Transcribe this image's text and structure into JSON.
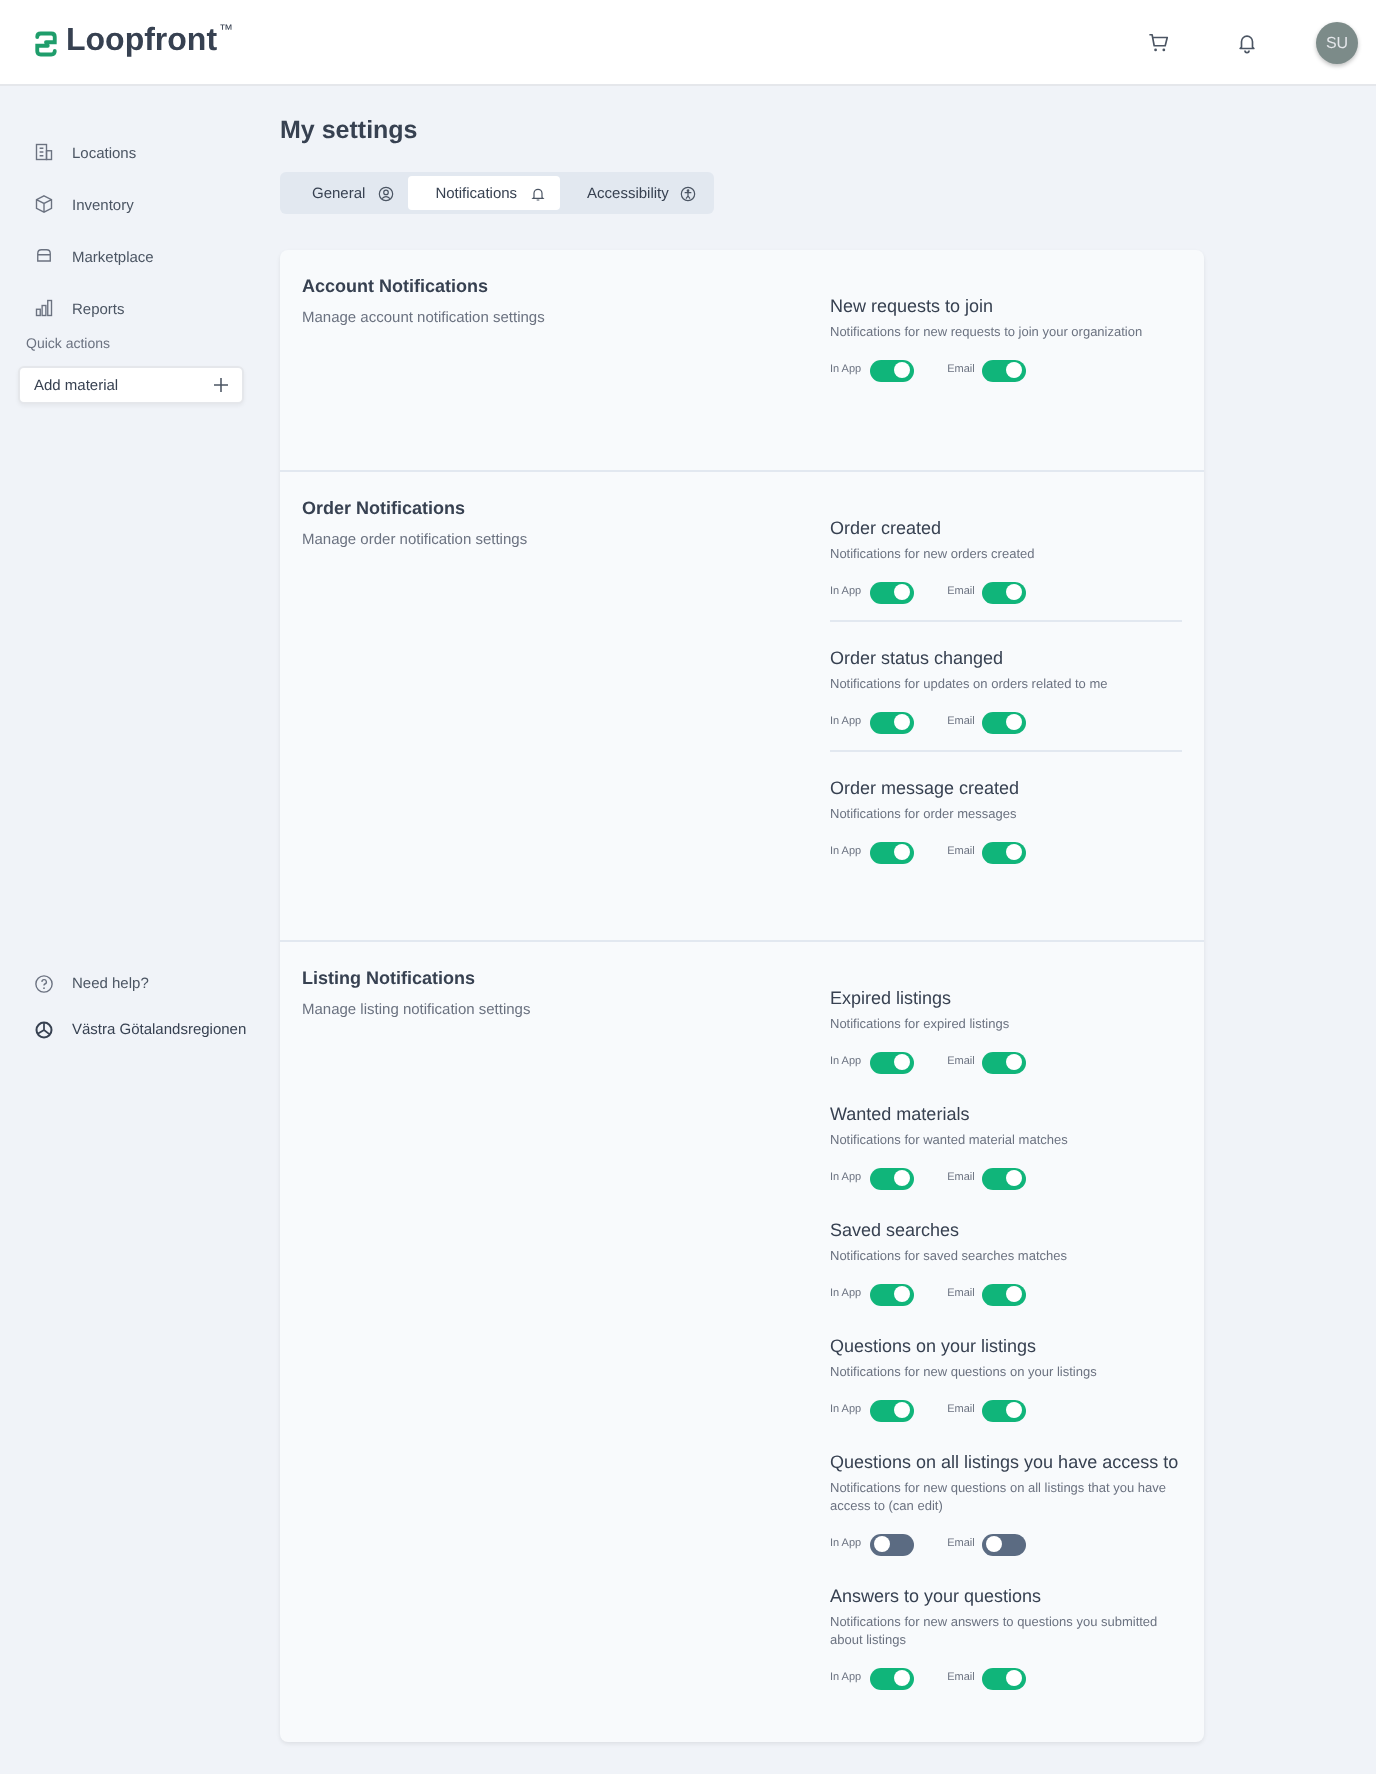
{
  "header": {
    "logo": "Loopfront",
    "trademark": "™",
    "avatar": "SU"
  },
  "sidebar": {
    "items": [
      {
        "label": "Locations",
        "kind": "building"
      },
      {
        "label": "Inventory",
        "kind": "box"
      },
      {
        "label": "Marketplace",
        "kind": "store"
      },
      {
        "label": "Reports",
        "kind": "chart"
      }
    ],
    "quick_actions_label": "Quick actions",
    "add_button": "Add material",
    "footer": [
      {
        "label": "Need help?",
        "kind": "help"
      },
      {
        "label": "Västra Götalandsregionen",
        "kind": "org"
      }
    ]
  },
  "page_title": "My settings",
  "tabs": [
    {
      "label": "General",
      "kind": "user",
      "selected": false
    },
    {
      "label": "Notifications",
      "kind": "bell",
      "selected": true
    },
    {
      "label": "Accessibility",
      "kind": "access",
      "selected": false
    }
  ],
  "sections": [
    {
      "title": "Account Notifications",
      "description": "Manage account notification settings",
      "dividers": false,
      "items": [
        {
          "title": "New requests to join",
          "description": "Notifications for new requests to join your organization",
          "in_app_label": "In App",
          "in_app": true,
          "email_label": "Email",
          "email": true
        }
      ]
    },
    {
      "title": "Order Notifications",
      "description": "Manage order notification settings",
      "dividers": true,
      "items": [
        {
          "title": "Order created",
          "description": "Notifications for new orders created",
          "in_app_label": "In App",
          "in_app": true,
          "email_label": "Email",
          "email": true
        },
        {
          "title": "Order status changed",
          "description": "Notifications for updates on orders related to me",
          "in_app_label": "In App",
          "in_app": true,
          "email_label": "Email",
          "email": true
        },
        {
          "title": "Order message created",
          "description": "Notifications for order messages",
          "in_app_label": "In App",
          "in_app": true,
          "email_label": "Email",
          "email": true
        }
      ]
    },
    {
      "title": "Listing Notifications",
      "description": "Manage listing notification settings",
      "dividers": false,
      "items": [
        {
          "title": "Expired listings",
          "description": "Notifications for expired listings",
          "in_app_label": "In App",
          "in_app": true,
          "email_label": "Email",
          "email": true
        },
        {
          "title": "Wanted materials",
          "description": "Notifications for wanted material matches",
          "in_app_label": "In App",
          "in_app": true,
          "email_label": "Email",
          "email": true
        },
        {
          "title": "Saved searches",
          "description": "Notifications for saved searches matches",
          "in_app_label": "In App",
          "in_app": true,
          "email_label": "Email",
          "email": true
        },
        {
          "title": "Questions on your listings",
          "description": "Notifications for new questions on your listings",
          "in_app_label": "In App",
          "in_app": true,
          "email_label": "Email",
          "email": true
        },
        {
          "title": "Questions on all listings you have access to",
          "description": "Notifications for new questions on all listings that you have access to (can edit)",
          "in_app_label": "In App",
          "in_app": false,
          "email_label": "Email",
          "email": false
        },
        {
          "title": "Answers to your questions",
          "description": "Notifications for new answers to questions you submitted about listings",
          "in_app_label": "In App",
          "in_app": true,
          "email_label": "Email",
          "email": true
        }
      ]
    }
  ]
}
